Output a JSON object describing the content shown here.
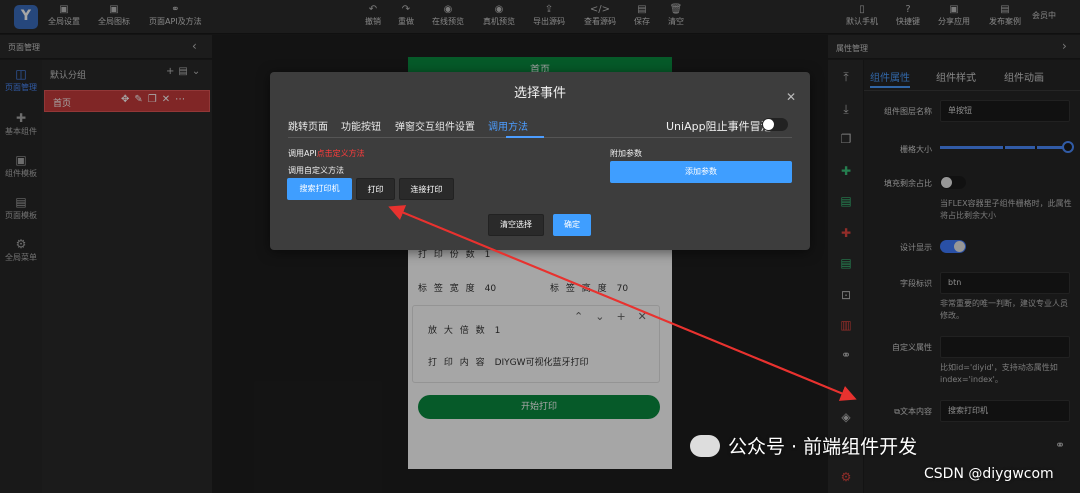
{
  "toolbar": {
    "left": [
      {
        "icon": "globe-settings-icon",
        "label": "全局设置"
      },
      {
        "icon": "globe-icon-icon",
        "label": "全局图标"
      },
      {
        "icon": "link-icon",
        "label": "页面API及方法"
      }
    ],
    "center": [
      {
        "icon": "undo-icon",
        "label": "撤销"
      },
      {
        "icon": "redo-icon",
        "label": "重做"
      },
      {
        "icon": "eye-icon",
        "label": "在线预览"
      },
      {
        "icon": "phone-eye-icon",
        "label": "真机预览"
      },
      {
        "icon": "export-icon",
        "label": "导出源码"
      },
      {
        "icon": "code-icon",
        "label": "查看源码"
      },
      {
        "icon": "save-icon",
        "label": "保存"
      },
      {
        "icon": "trash-icon",
        "label": "清空"
      }
    ],
    "right": [
      {
        "icon": "phone-icon",
        "label": "默认手机"
      },
      {
        "icon": "help-icon",
        "label": "快捷键"
      },
      {
        "icon": "share-icon",
        "label": "分享应用"
      },
      {
        "icon": "publish-icon",
        "label": "发布案例"
      }
    ],
    "member": "会员中"
  },
  "left_panel": {
    "title": "页面管理",
    "rail": [
      {
        "icon": "page-manage-icon",
        "label": "页面管理"
      },
      {
        "icon": "puzzle-icon",
        "label": "基本组件"
      },
      {
        "icon": "template-icon",
        "label": "组件模板"
      },
      {
        "icon": "page-template-icon",
        "label": "页面模板"
      },
      {
        "icon": "menu-gear-icon",
        "label": "全局菜单"
      }
    ],
    "group_label": "默认分组",
    "page_name": "首页"
  },
  "phone": {
    "nav_title": "首页",
    "print_copies_label": "打 印 份 数",
    "print_copies_value": "1",
    "label_width_label": "标 签 宽 度",
    "label_width_value": "40",
    "label_height_label": "标 签 高 度",
    "label_height_value": "70",
    "zoom_label": "放 大 倍 数",
    "zoom_value": "1",
    "content_label": "打 印 内 容",
    "content_value": "DIYGW可视化蓝牙打印",
    "start_button": "开始打印"
  },
  "modal": {
    "title": "选择事件",
    "tabs": [
      "跳转页面",
      "功能按钮",
      "弹窗交互组件设置",
      "调用方法"
    ],
    "active_tab": 3,
    "uniapp_label": "UniApp阻止事件冒泡",
    "api_prefix": "调用API",
    "api_link": "点击定义方法",
    "custom_method_label": "调用自定义方法",
    "method_buttons": [
      "搜索打印机",
      "打印",
      "连接打印"
    ],
    "extra_params_label": "附加参数",
    "add_param_button": "添加参数",
    "clear_button": "清空选择",
    "ok_button": "确定"
  },
  "right_panel": {
    "title": "属性管理",
    "tabs": [
      "组件属性",
      "组件样式",
      "组件动画"
    ],
    "rows": {
      "layer_name_label": "组件图层名称",
      "layer_name_value": "单按钮",
      "grid_label": "栅格大小",
      "fill_label": "填充剩余占比",
      "fill_hint": "当FLEX容器里子组件栅格时，此属性将占比剩余大小",
      "design_show_label": "设计显示",
      "field_id_label": "字段标识",
      "field_id_value": "btn",
      "field_id_hint": "非常重要的唯一判断，建议专业人员修改。",
      "custom_attr_label": "自定义属性",
      "custom_attr_value": "",
      "custom_attr_hint": "比如id='diyid'，支持动态属性如index='index'。",
      "text_content_label": "文本内容",
      "text_content_value": "搜索打印机"
    }
  },
  "watermark": {
    "wechat": "公众号 · 前端组件开发",
    "csdn": "CSDN @diygwcom"
  },
  "colors": {
    "accent": "#3f9eff",
    "danger": "#e0453f",
    "success": "#0a8a3f"
  }
}
